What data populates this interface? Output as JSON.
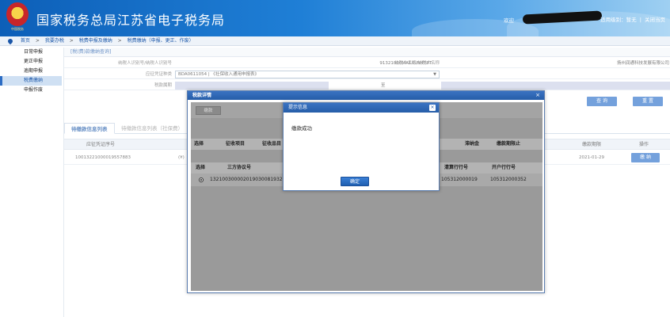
{
  "header": {
    "site_title": "国家税务总局江苏省电子税务局",
    "emblem_text": "中国税务",
    "welcome": "欢迎",
    "role_label": "适用级别：暂无",
    "divider": "|",
    "close_label": "关闭当页"
  },
  "breadcrumb": {
    "items": [
      "首页",
      "我要办税",
      "税费申报及缴纳",
      "税费缴纳（申报、更正、作废）"
    ],
    "sep": ">"
  },
  "sidebar": {
    "items": [
      {
        "label": "日常申报"
      },
      {
        "label": "更正申报"
      },
      {
        "label": "逾期申报"
      },
      {
        "label": "税费缴纳"
      },
      {
        "label": "申报作废"
      }
    ]
  },
  "query": {
    "title": "[税(费)款缴纳查询]",
    "taxpayer_id_label": "纳税人识别号/纳税人识别号",
    "taxpayer_id_value": "91321000MA1XUN4T8T",
    "taxpayer_name_label": "纳税人名称/纳税人名称",
    "taxpayer_name_value": "扬州润通科技发展有限公司",
    "voucher_label": "应征凭证种类",
    "voucher_value": "BDA0611054 | 《社保收入通用申报表》",
    "tax_period_label": "税款属期",
    "tax_period_sep": "至",
    "query_btn": "查 询",
    "reset_btn": "重 置"
  },
  "tabs": [
    "待缴款信息列表",
    "待缴款信息列表（社保费）"
  ],
  "grid": {
    "headers": [
      "应征凭证序号",
      "缴款期限",
      "操作"
    ],
    "row": {
      "serial": "10013221000019557883",
      "partial": "(¥)",
      "deadline": "2021-01-29",
      "pay_btn": "缴 纳"
    }
  },
  "tax_dialog": {
    "title": "税款详情",
    "close": "×",
    "pay_btn": "缴款",
    "headers1": [
      "选择",
      "征收项目",
      "征收品目",
      "滞纳金",
      "缴款期限止"
    ],
    "headers2": [
      "选择",
      "三方协议号",
      "清算行行号",
      "开户行行号"
    ],
    "row": {
      "agreement_no": "132100300002019030081932",
      "settle_bank": "105312000019",
      "open_bank": "105312000352"
    }
  },
  "message": {
    "title": "提示信息",
    "close": "×",
    "text": "缴款成功",
    "ok_btn": "确定"
  }
}
